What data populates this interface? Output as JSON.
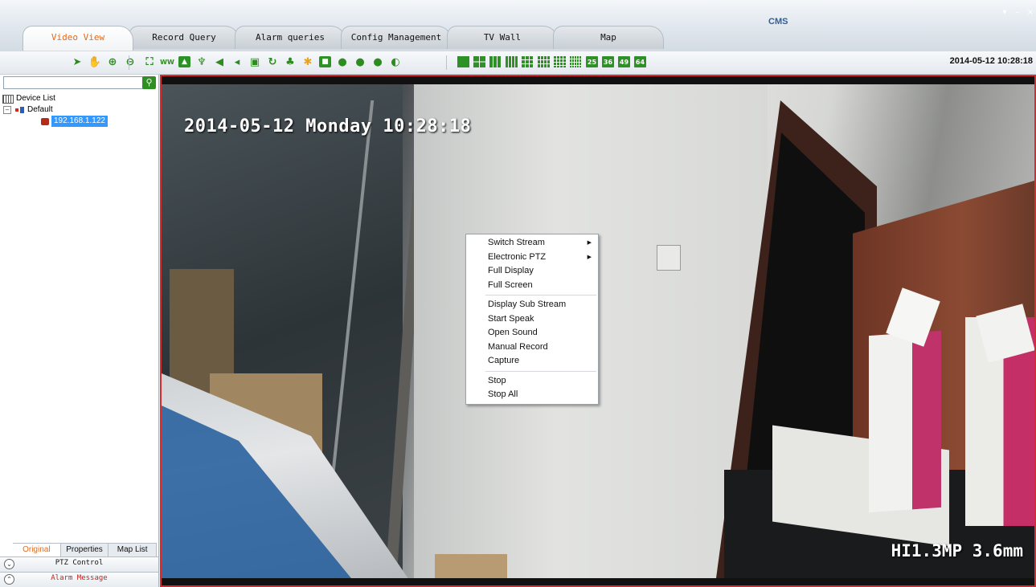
{
  "app": {
    "title": "CMS",
    "window_controls": [
      "▾",
      "–",
      "×"
    ]
  },
  "tabs": [
    {
      "label": "Video View",
      "active": true
    },
    {
      "label": "Record Query",
      "active": false
    },
    {
      "label": "Alarm queries",
      "active": false
    },
    {
      "label": "Config Management",
      "active": false
    },
    {
      "label": "TV Wall",
      "active": false
    },
    {
      "label": "Map",
      "active": false
    }
  ],
  "toolbar": {
    "clock": "2014-05-12 10:28:18",
    "ptz_icons": [
      "pointer-icon",
      "hand-icon",
      "zoom-in-icon",
      "zoom-out-icon"
    ],
    "action_icons": [
      "fullscreen-icon",
      "ww-icon",
      "image-icon",
      "microphone-icon",
      "speaker-icon",
      "talk-icon",
      "record-icon",
      "refresh-icon",
      "alarm-icon",
      "fit-icon",
      "capture-icon",
      "stop-icon",
      "pause-icon",
      "play-icon",
      "circle-icon"
    ],
    "layout_labels": {
      "l25": "25",
      "l36": "36",
      "l49": "49",
      "l64": "64"
    }
  },
  "accent_color": "#2d9126",
  "left_panel": {
    "search": {
      "value": "",
      "placeholder": ""
    },
    "tree": {
      "root": "Device List",
      "group": "Default",
      "device": "192.168.1.122"
    },
    "bottom_tabs": [
      {
        "label": "Original",
        "active": true
      },
      {
        "label": "Properties",
        "active": false
      },
      {
        "label": "Map List",
        "active": false
      }
    ],
    "ptz_control": "PTZ Control",
    "alarm_message": "Alarm Message"
  },
  "video": {
    "osd_time": "2014-05-12 Monday 10:28:18",
    "osd_camera": "HI1.3MP 3.6mm"
  },
  "context_menu": {
    "switch_stream": "Switch Stream",
    "electronic_ptz": "Electronic PTZ",
    "full_display": "Full Display",
    "full_screen": "Full Screen",
    "display_sub_stream": "Display Sub Stream",
    "start_speak": "Start Speak",
    "open_sound": "Open Sound",
    "manual_record": "Manual Record",
    "capture": "Capture",
    "stop": "Stop",
    "stop_all": "Stop All"
  }
}
